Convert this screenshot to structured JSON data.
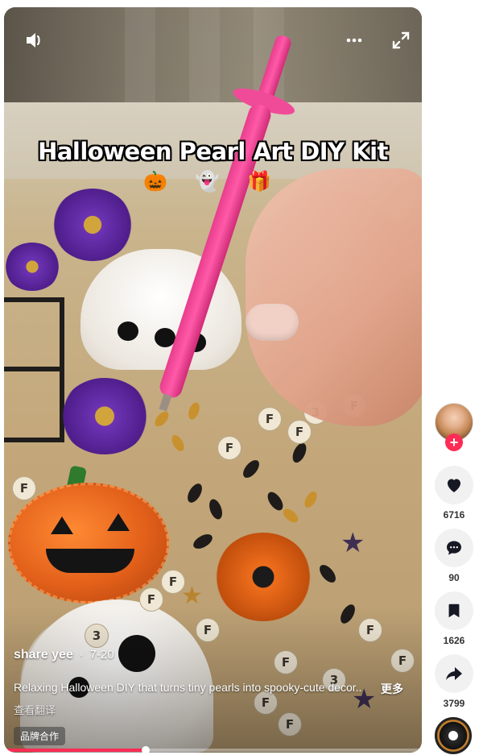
{
  "video": {
    "caption_title": "Halloween Pearl Art DIY Kit",
    "caption_emoji": "🎃 👻 🎁",
    "bead_label": "F",
    "bead_number": "3",
    "author": "share yee",
    "separator": "·",
    "date": "7-20",
    "description": "Relaxing Halloween DIY that turns tiny pearls into spooky-cute decor..",
    "more_label": "更多",
    "translate_label": "查看翻译",
    "brand_tag": "品牌合作",
    "progress_percent": 34
  },
  "controls": {
    "volume_icon": "volume-icon",
    "more_icon": "more-horizontal-icon",
    "expand_icon": "fullscreen-icon"
  },
  "rail": {
    "follow_label": "+",
    "likes": "6716",
    "comments": "90",
    "saves": "1626",
    "shares": "3799"
  },
  "colors": {
    "accent": "#fe2c55",
    "rail_button_bg": "#f1f1f2",
    "pen_pink": "#ff5aa8"
  }
}
